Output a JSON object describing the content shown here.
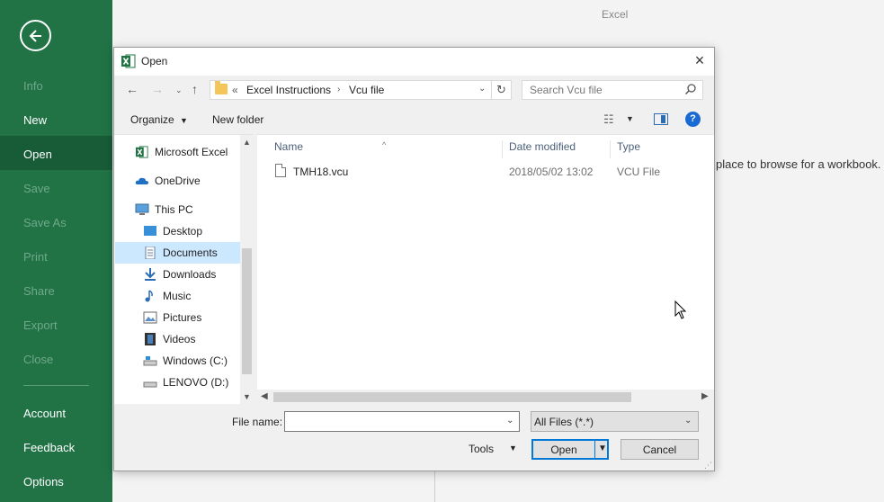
{
  "app": {
    "title": "Excel"
  },
  "backstage": {
    "items": [
      {
        "label": "Info",
        "enabled": false
      },
      {
        "label": "New",
        "enabled": true
      },
      {
        "label": "Open",
        "enabled": true,
        "selected": true
      },
      {
        "label": "Save",
        "enabled": false
      },
      {
        "label": "Save As",
        "enabled": false
      },
      {
        "label": "Print",
        "enabled": false
      },
      {
        "label": "Share",
        "enabled": false
      },
      {
        "label": "Export",
        "enabled": false
      },
      {
        "label": "Close",
        "enabled": false
      }
    ],
    "bottom_items": [
      {
        "label": "Account"
      },
      {
        "label": "Feedback"
      },
      {
        "label": "Options"
      }
    ],
    "browse_hint": "place to browse for a workbook."
  },
  "dialog": {
    "title": "Open",
    "breadcrumb": [
      "«",
      "Excel Instructions",
      "Vcu file"
    ],
    "search_placeholder": "Search Vcu file",
    "toolbar": {
      "organize": "Organize",
      "new_folder": "New folder",
      "help": "?"
    },
    "nav_items": [
      {
        "label": "Microsoft Excel",
        "icon": "excel-icon"
      },
      {
        "label": "OneDrive",
        "icon": "cloud-icon"
      },
      {
        "label": "This PC",
        "icon": "computer-icon"
      },
      {
        "label": "Desktop",
        "icon": "desktop-icon"
      },
      {
        "label": "Documents",
        "icon": "documents-icon",
        "selected": true
      },
      {
        "label": "Downloads",
        "icon": "download-icon"
      },
      {
        "label": "Music",
        "icon": "music-icon"
      },
      {
        "label": "Pictures",
        "icon": "pictures-icon"
      },
      {
        "label": "Videos",
        "icon": "videos-icon"
      },
      {
        "label": "Windows (C:)",
        "icon": "drive-icon"
      },
      {
        "label": "LENOVO (D:)",
        "icon": "drive-icon"
      }
    ],
    "columns": {
      "name": "Name",
      "date": "Date modified",
      "type": "Type"
    },
    "files": [
      {
        "name": "TMH18.vcu",
        "date": "2018/05/02 13:02",
        "type": "VCU File"
      }
    ],
    "file_name_label": "File name:",
    "file_name_value": "",
    "filter": "All Files (*.*)",
    "tools": "Tools",
    "open": "Open",
    "cancel": "Cancel"
  },
  "colors": {
    "accent": "#217346",
    "selection": "#cce8ff",
    "button_focus": "#0078d7"
  }
}
